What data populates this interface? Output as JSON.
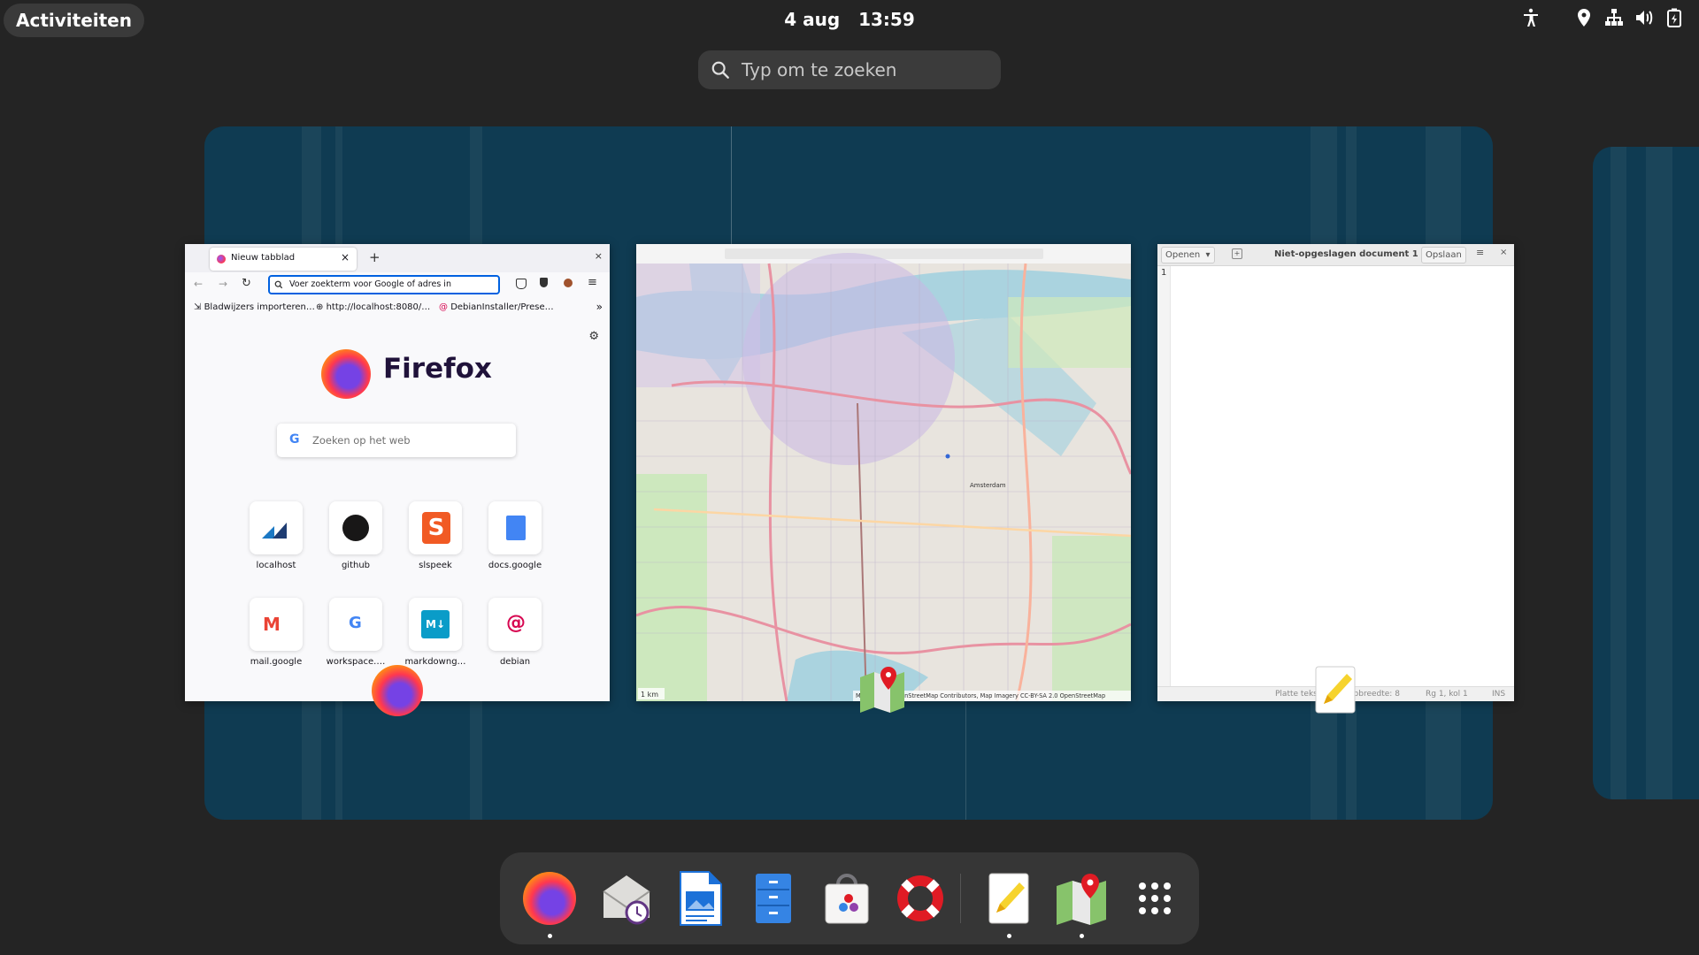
{
  "topbar": {
    "activities_label": "Activiteiten",
    "date": "4 aug",
    "time": "13:59",
    "tray_icons": [
      "accessibility-icon",
      "location-icon",
      "network-icon",
      "volume-icon",
      "battery-icon"
    ]
  },
  "search": {
    "placeholder": "Typ om te zoeken"
  },
  "windows": {
    "firefox": {
      "tab_title": "Nieuw tabblad",
      "url_placeholder": "Voer zoekterm voor Google of adres in",
      "bookmarks": [
        "Bladwijzers importeren…",
        "http://localhost:8080/…",
        "DebianInstaller/Prese…"
      ],
      "brand": "Firefox",
      "web_search_placeholder": "Zoeken op het web",
      "shortcuts": [
        {
          "label": "localhost",
          "icon": "localhost-icon"
        },
        {
          "label": "github",
          "icon": "github-icon"
        },
        {
          "label": "slspeek",
          "icon": "slspeek-icon"
        },
        {
          "label": "docs.google",
          "icon": "google-docs-icon"
        },
        {
          "label": "mail.google",
          "icon": "gmail-icon"
        },
        {
          "label": "workspace.…",
          "icon": "google-icon"
        },
        {
          "label": "markdowng…",
          "icon": "markdown-icon"
        },
        {
          "label": "debian",
          "icon": "debian-icon"
        }
      ]
    },
    "maps": {
      "scale": "1 km",
      "attribution": "Map data © OpenStreetMap Contributors, Map Imagery CC-BY-SA 2.0 OpenStreetMap",
      "city_label": "Amsterdam"
    },
    "editor": {
      "open_label": "Openen",
      "title": "Niet-opgeslagen document 1",
      "save_label": "Opslaan",
      "line_number": "1",
      "status_type": "Platte tekst",
      "status_tab": "Tabbreedte: 8",
      "status_pos": "Rg 1, kol 1",
      "status_ins": "INS"
    }
  },
  "dock": {
    "items": [
      "firefox-icon",
      "evolution-mail-icon",
      "libreoffice-writer-icon",
      "file-manager-icon",
      "software-store-icon",
      "help-icon",
      "text-editor-icon",
      "maps-icon",
      "app-grid-icon"
    ],
    "running": [
      "firefox-icon",
      "text-editor-icon",
      "maps-icon"
    ]
  },
  "colors": {
    "shell_bg": "#242424",
    "workspace_bg": "#0f3b52",
    "firefox_focus": "#0061e0"
  }
}
